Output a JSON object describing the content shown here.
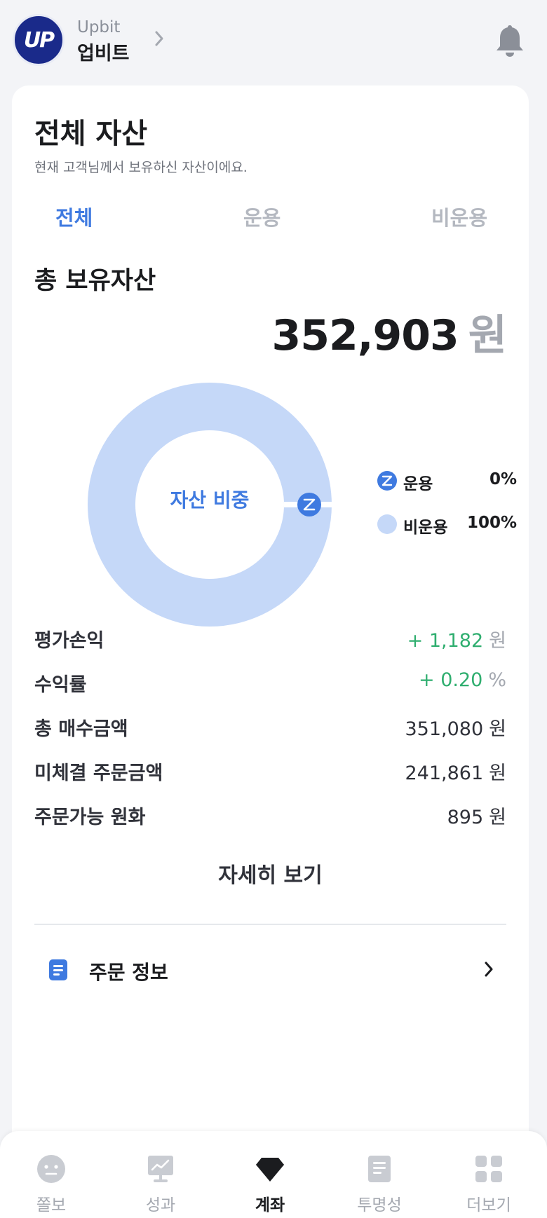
{
  "header": {
    "logo_text": "UP",
    "brand_en": "Upbit",
    "brand_ko": "업비트"
  },
  "card": {
    "title": "전체 자산",
    "subtitle": "현재 고객님께서 보유하신 자산이에요.",
    "tabs": [
      {
        "label": "전체",
        "active": true
      },
      {
        "label": "운용",
        "active": false
      },
      {
        "label": "비운용",
        "active": false
      }
    ],
    "total_label": "총 보유자산",
    "total_value": "352,903",
    "total_unit": "원",
    "chart_center_label": "자산 비중",
    "legend": [
      {
        "name": "운용",
        "pct": "0%",
        "color": "#3f7ae0"
      },
      {
        "name": "비운용",
        "pct": "100%",
        "color": "#c5d8f8"
      }
    ],
    "stats": [
      {
        "label": "평가손익",
        "value": "+ 1,182",
        "unit": "원",
        "positive": true
      },
      {
        "label": "수익률",
        "value": "+ 0.20",
        "unit": "%",
        "positive": true
      },
      {
        "label": "총 매수금액",
        "value": "351,080",
        "unit": "원",
        "positive": false
      },
      {
        "label": "미체결 주문금액",
        "value": "241,861",
        "unit": "원",
        "positive": false
      },
      {
        "label": "주문가능 원화",
        "value": "895",
        "unit": "원",
        "positive": false
      }
    ],
    "detail_button": "자세히 보기",
    "order_info_label": "주문 정보"
  },
  "chart_data": {
    "type": "pie",
    "categories": [
      "운용",
      "비운용"
    ],
    "values": [
      0,
      100
    ],
    "title": "자산 비중"
  },
  "nav": {
    "items": [
      {
        "label": "쫄보",
        "icon": "face-icon",
        "active": false
      },
      {
        "label": "성과",
        "icon": "chart-board-icon",
        "active": false
      },
      {
        "label": "계좌",
        "icon": "diamond-icon",
        "active": true
      },
      {
        "label": "투명성",
        "icon": "document-icon",
        "active": false
      },
      {
        "label": "더보기",
        "icon": "grid-icon",
        "active": false
      }
    ]
  },
  "colors": {
    "accent": "#3f7ae0",
    "positive": "#2fae6f",
    "donut_fill": "#c5d8f8",
    "logo_bg": "#1a2a8a"
  }
}
